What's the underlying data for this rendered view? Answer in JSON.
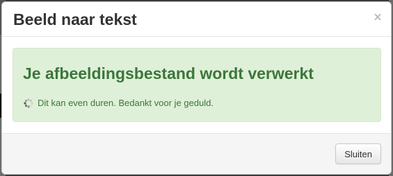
{
  "modal": {
    "title": "Beeld naar tekst",
    "close_glyph": "×",
    "close_icon": "close-icon"
  },
  "alert": {
    "heading": "Je afbeeldingsbestand wordt verwerkt",
    "message": "Dit kan even duren. Bedankt voor je geduld.",
    "icon": "loading-spinner-icon",
    "colors": {
      "background": "#dff0d8",
      "text": "#3c763d",
      "border": "#d6e9c6"
    }
  },
  "footer": {
    "close_label": "Sluiten"
  }
}
